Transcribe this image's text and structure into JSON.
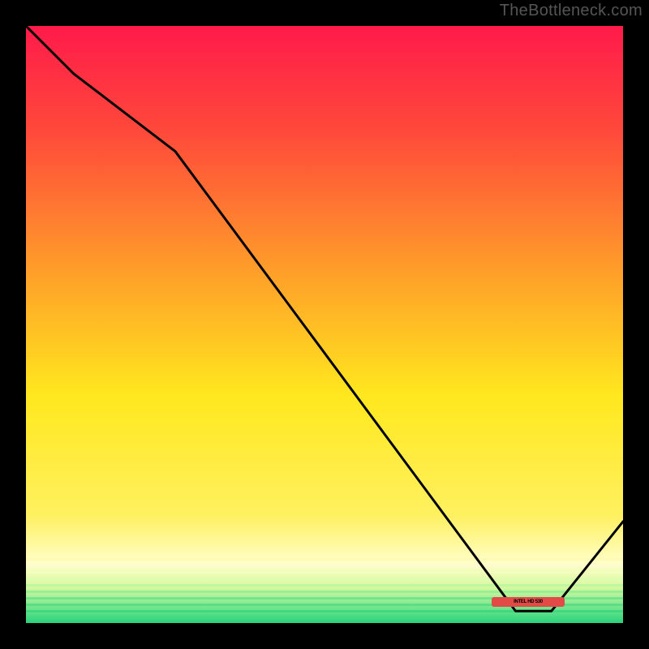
{
  "watermark": "TheBottleneck.com",
  "x_chip_label": "INTEL HD 530",
  "chart_data": {
    "type": "line",
    "title": "",
    "xlabel": "",
    "ylabel": "",
    "xlim": [
      0,
      100
    ],
    "ylim": [
      0,
      100
    ],
    "grid": false,
    "legend": false,
    "bands_note": "full-width horizontal gradient bands from red (top) through orange, yellow, pale-yellow to green (bottom)",
    "x": [
      0,
      8,
      25,
      82,
      88,
      100
    ],
    "values": [
      100,
      92,
      79,
      2,
      2,
      17
    ],
    "x_marker_range": [
      79,
      90
    ]
  },
  "colors": {
    "frame": "#000000",
    "red_top": "#ff1a4a",
    "orange": "#ffa02a",
    "yellow": "#ffe820",
    "pale": "#ffffc0",
    "green": "#28d37c",
    "line": "#000000",
    "watermark": "#555555",
    "chip": "#e24a47"
  }
}
